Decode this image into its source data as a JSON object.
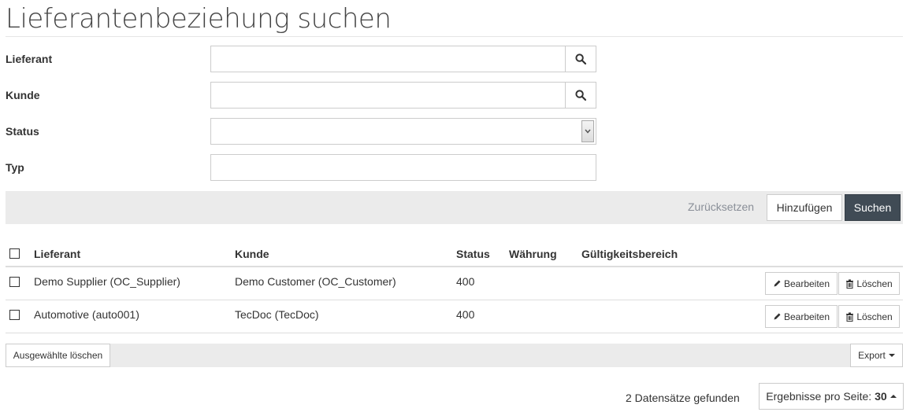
{
  "page": {
    "title": "Lieferantenbeziehung suchen"
  },
  "form": {
    "supplier": {
      "label": "Lieferant",
      "value": ""
    },
    "customer": {
      "label": "Kunde",
      "value": ""
    },
    "status": {
      "label": "Status",
      "selected": ""
    },
    "type": {
      "label": "Typ",
      "value": ""
    }
  },
  "actions": {
    "reset": "Zurücksetzen",
    "add": "Hinzufügen",
    "search": "Suchen"
  },
  "table": {
    "columns": [
      "Lieferant",
      "Kunde",
      "Status",
      "Währung",
      "Gültigkeitsbereich"
    ],
    "rows": [
      {
        "supplier": "Demo Supplier (OC_Supplier)",
        "customer": "Demo Customer (OC_Customer)",
        "status": "400",
        "currency": "",
        "scope": ""
      },
      {
        "supplier": "Automotive (auto001)",
        "customer": "TecDoc (TecDoc)",
        "status": "400",
        "currency": "",
        "scope": ""
      }
    ],
    "row_actions": {
      "edit": "Bearbeiten",
      "delete": "Löschen"
    }
  },
  "bulk": {
    "delete_selected": "Ausgewählte löschen",
    "export": "Export"
  },
  "footer": {
    "records_found": "2 Datensätze gefunden",
    "page_size_label": "Ergebnisse pro Seite:",
    "page_size_value": "30"
  },
  "colors": {
    "primary_button": "#404b55",
    "bar_background": "#ebebeb",
    "link": "#8a8f98"
  },
  "icons": {
    "search": "search-icon",
    "edit": "pencil-icon",
    "delete": "trash-icon"
  }
}
